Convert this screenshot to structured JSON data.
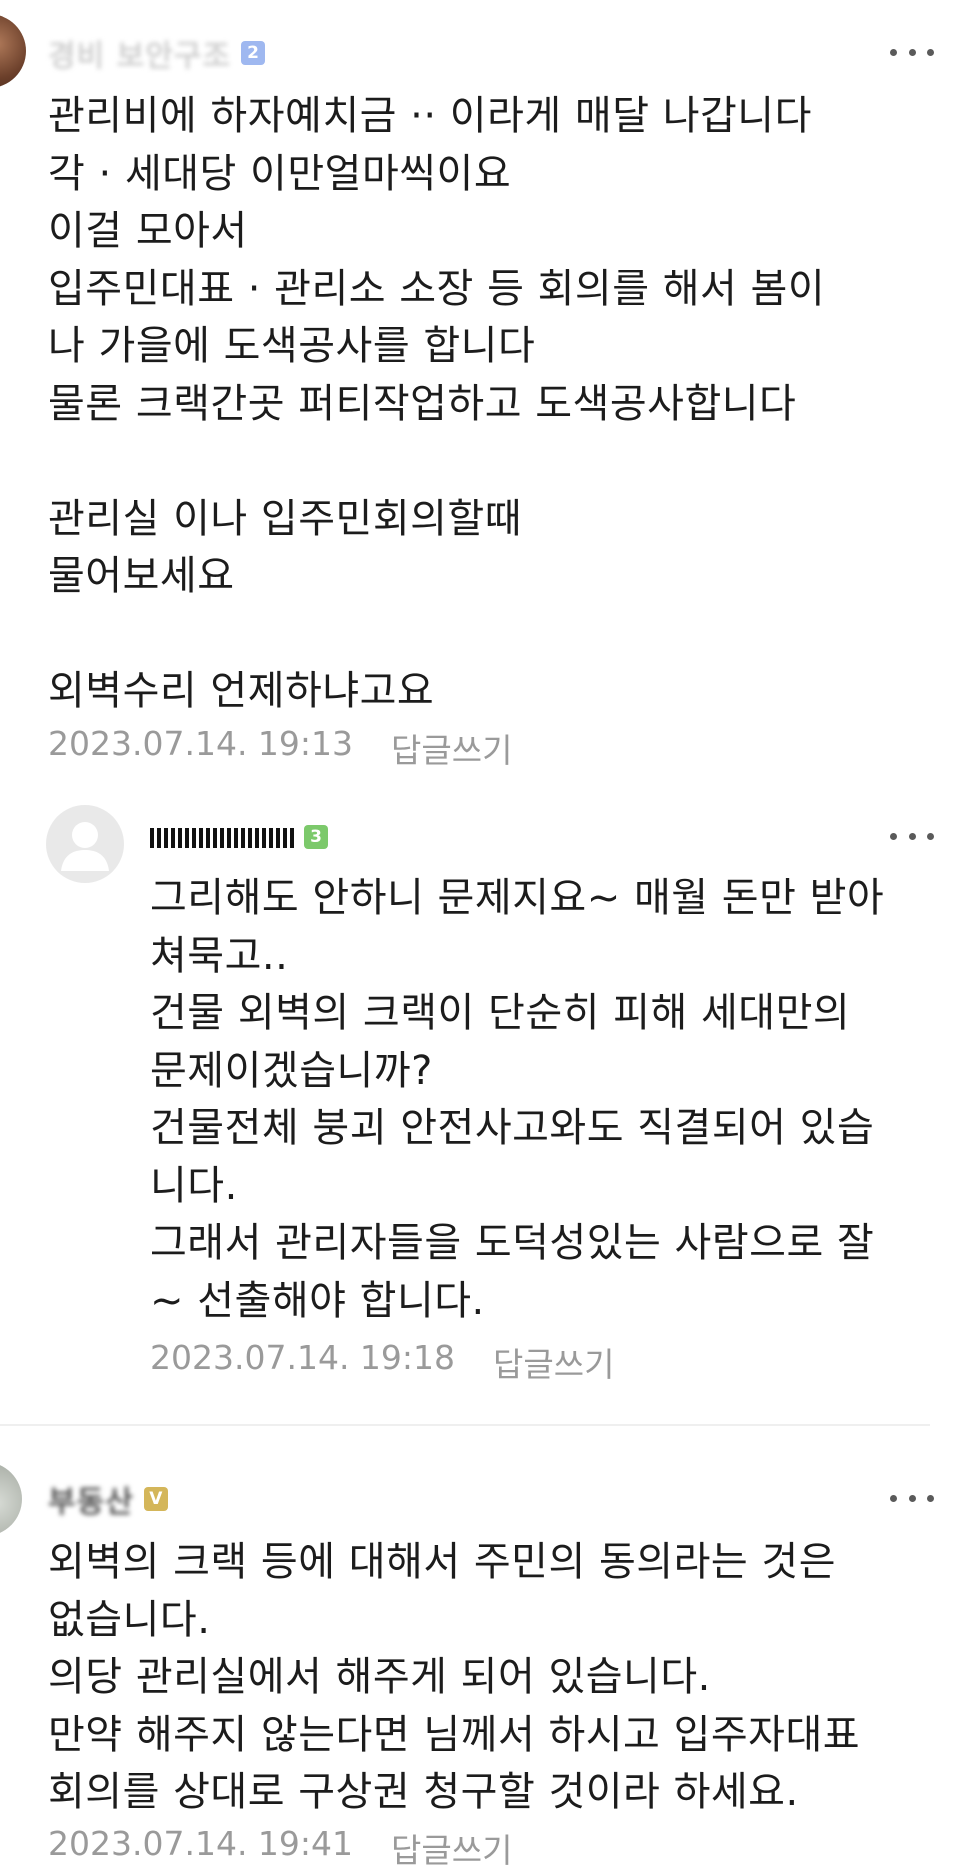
{
  "comments": [
    {
      "nickname": "경비 보안구조",
      "level": "2",
      "text": "관리비에 하자예치금 ·· 이라게 매달 나갑니다\n각 · 세대당 이만얼마씩이요\n이걸 모아서\n입주민대표 · 관리소 소장 등 회의를 해서 봄이\n나 가을에 도색공사를 합니다\n물론 크랙간곳 퍼티작업하고 도색공사합니다\n\n관리실 이나 입주민회의할때\n물어보세요\n\n외벽수리 언제하냐고요",
      "date": "2023.07.14. 19:13",
      "reply_label": "답글쓰기"
    },
    {
      "nickname": "",
      "level": "3",
      "text": "그리해도 안하니 문제지요~ 매월 돈만 받아\n쳐묵고..\n건물 외벽의 크랙이 단순히 피해 세대만의\n문제이겠습니까?\n건물전체 붕괴 안전사고와도 직결되어 있습\n니다.\n그래서 관리자들을 도덕성있는 사람으로 잘\n~ 선출해야 합니다.",
      "date": "2023.07.14. 19:18",
      "reply_label": "답글쓰기"
    },
    {
      "nickname": "부동산",
      "level": "V",
      "text": "외벽의 크랙 등에 대해서 주민의 동의라는 것은\n없습니다.\n의당 관리실에서 해주게 되어 있습니다.\n만약 해주지 않는다면 님께서 하시고 입주자대표\n회의를 상대로 구상권 청구할 것이라 하세요.",
      "date": "2023.07.14. 19:41",
      "reply_label": "답글쓰기"
    }
  ],
  "icons": {
    "more": "more-dots-icon",
    "default_avatar": "user-silhouette-icon"
  },
  "colors": {
    "level_blue": "#9fb8f0",
    "level_green": "#7cc96b",
    "level_gold": "#d4b65a",
    "meta_gray": "#9a9a9a"
  }
}
